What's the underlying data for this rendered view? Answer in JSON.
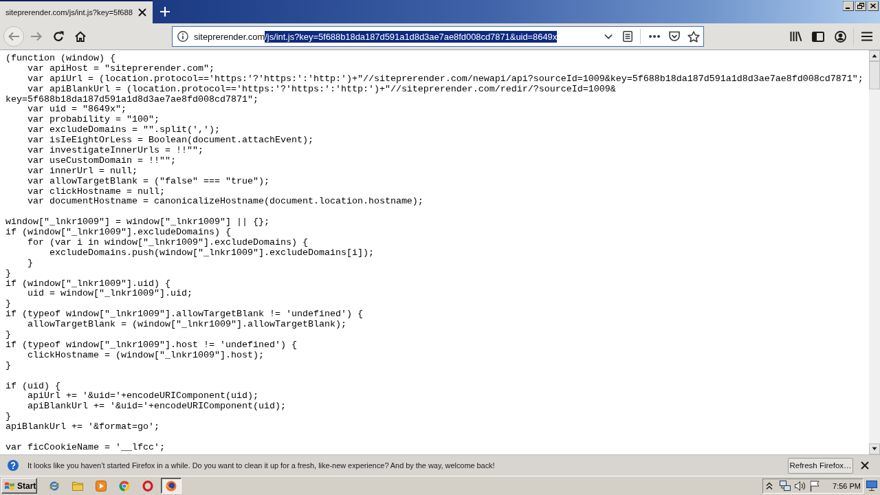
{
  "window": {
    "tabs": [
      {
        "title": "siteprerender.com/js/int.js?key=5f688",
        "selected": true
      }
    ]
  },
  "toolbar": {
    "nav_buttons": [
      {
        "kind": "back",
        "disabled": true
      },
      {
        "kind": "forward",
        "disabled": true
      },
      {
        "kind": "reload",
        "disabled": false
      },
      {
        "kind": "home",
        "disabled": false
      }
    ],
    "address": {
      "url_parts": [
        {
          "text": "siteprerender.com",
          "selected": false
        },
        {
          "text": "/js/int.js?key=5f688b18da187d591a1d8d3ae7ae8fd008cd7871&uid=8649x",
          "selected": true
        }
      ]
    }
  },
  "code": {
    "blocks": [
      [
        "(function (window) {",
        "    var apiHost = \"siteprerender.com\";",
        "    var apiUrl = (location.protocol=='https:'?'https:':'http:')+\"//siteprerender.com/newapi/api?sourceId=1009&key=5f688b18da187d591a1d8d3ae7ae8fd008cd7871\";",
        "    var apiBlankUrl = (location.protocol=='https:'?'https:':'http:')+\"//siteprerender.com/redir/?sourceId=1009&",
        "key=5f688b18da187d591a1d8d3ae7ae8fd008cd7871\";",
        "    var uid = \"8649x\";",
        "    var probability = \"100\";",
        "    var excludeDomains = \"\".split(',');",
        "    var isIeEightOrLess = Boolean(document.attachEvent);",
        "    var investigateInnerUrls = !!\"\";",
        "    var useCustomDomain = !!\"\";",
        "    var innerUrl = null;",
        "    var allowTargetBlank = (\"false\" === \"true\");",
        "    var clickHostname = null;",
        "    var documentHostname = canonicalizeHostname(document.location.hostname);"
      ],
      [
        "window[\"_lnkr1009\"] = window[\"_lnkr1009\"] || {};",
        "if (window[\"_lnkr1009\"].excludeDomains) {",
        "    for (var i in window[\"_lnkr1009\"].excludeDomains) {",
        "        excludeDomains.push(window[\"_lnkr1009\"].excludeDomains[i]);",
        "    }",
        "}",
        "if (window[\"_lnkr1009\"].uid) {",
        "    uid = window[\"_lnkr1009\"].uid;",
        "}",
        "if (typeof window[\"_lnkr1009\"].allowTargetBlank != 'undefined') {",
        "    allowTargetBlank = (window[\"_lnkr1009\"].allowTargetBlank);",
        "}",
        "if (typeof window[\"_lnkr1009\"].host != 'undefined') {",
        "    clickHostname = (window[\"_lnkr1009\"].host);",
        "}"
      ],
      [
        "if (uid) {",
        "    apiUrl += '&uid='+encodeURIComponent(uid);",
        "    apiBlankUrl += '&uid='+encodeURIComponent(uid);",
        "}",
        "apiBlankUrl += '&format=go';"
      ],
      [
        "var ficCookieName = '__lfcc';"
      ]
    ]
  },
  "notification": {
    "message": "It looks like you haven’t started Firefox in a while. Do you want to clean it up for a fresh, like-new experience? And by the way, welcome back!",
    "button": "Refresh Firefox…"
  },
  "taskbar": {
    "start": "Start",
    "apps": [
      {
        "kind": "ie",
        "selected": false
      },
      {
        "kind": "folder",
        "selected": false
      },
      {
        "kind": "media",
        "selected": false
      },
      {
        "kind": "chrome",
        "selected": false
      },
      {
        "kind": "opera",
        "selected": false
      },
      {
        "kind": "firefox",
        "selected": true
      }
    ],
    "clock": "7:56 PM"
  }
}
